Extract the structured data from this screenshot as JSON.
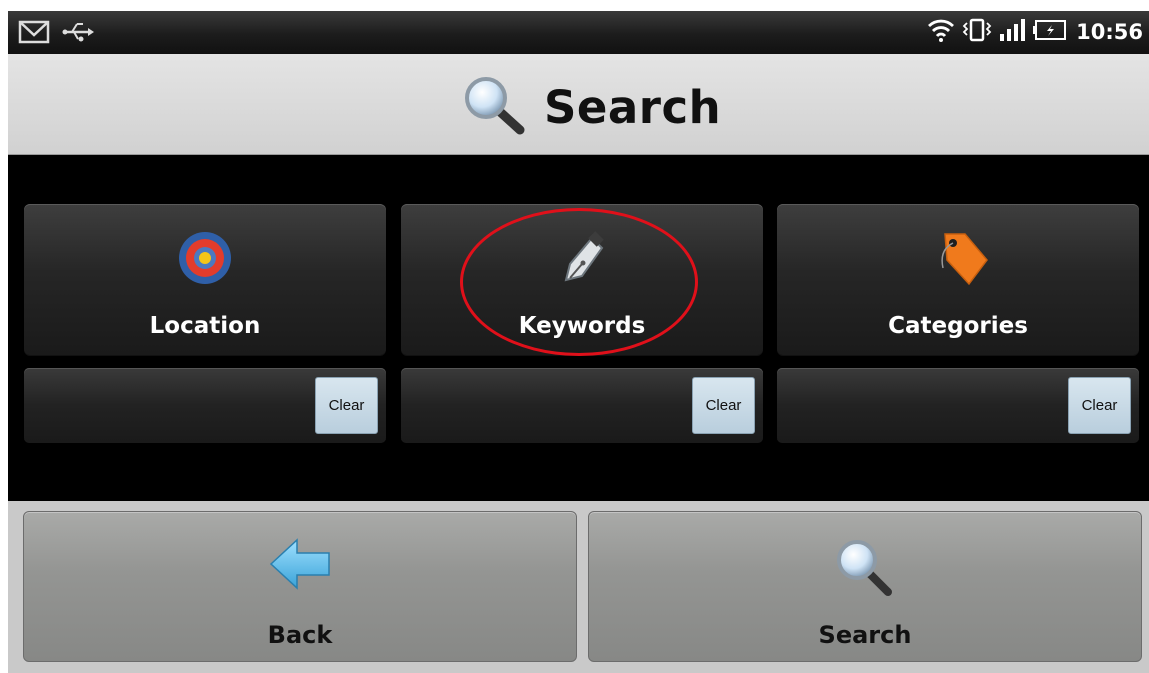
{
  "status_bar": {
    "time": "10:56",
    "left_icons": [
      "gmail-icon",
      "usb-icon"
    ],
    "right_icons": [
      "wifi-icon",
      "vibrate-icon",
      "signal-icon",
      "battery-icon"
    ]
  },
  "header": {
    "title": "Search",
    "icon": "magnifier-icon"
  },
  "filters": [
    {
      "label": "Location",
      "icon": "target-icon",
      "value": "",
      "clear_label": "Clear"
    },
    {
      "label": "Keywords",
      "icon": "pen-nib-icon",
      "value": "",
      "clear_label": "Clear"
    },
    {
      "label": "Categories",
      "icon": "tag-icon",
      "value": "",
      "clear_label": "Clear"
    }
  ],
  "bottom_nav": {
    "back_label": "Back",
    "back_icon": "arrow-left-icon",
    "search_label": "Search",
    "search_icon": "magnifier-icon"
  },
  "annotation": {
    "type": "red-ellipse",
    "target": "Keywords",
    "color": "#e0101a"
  }
}
